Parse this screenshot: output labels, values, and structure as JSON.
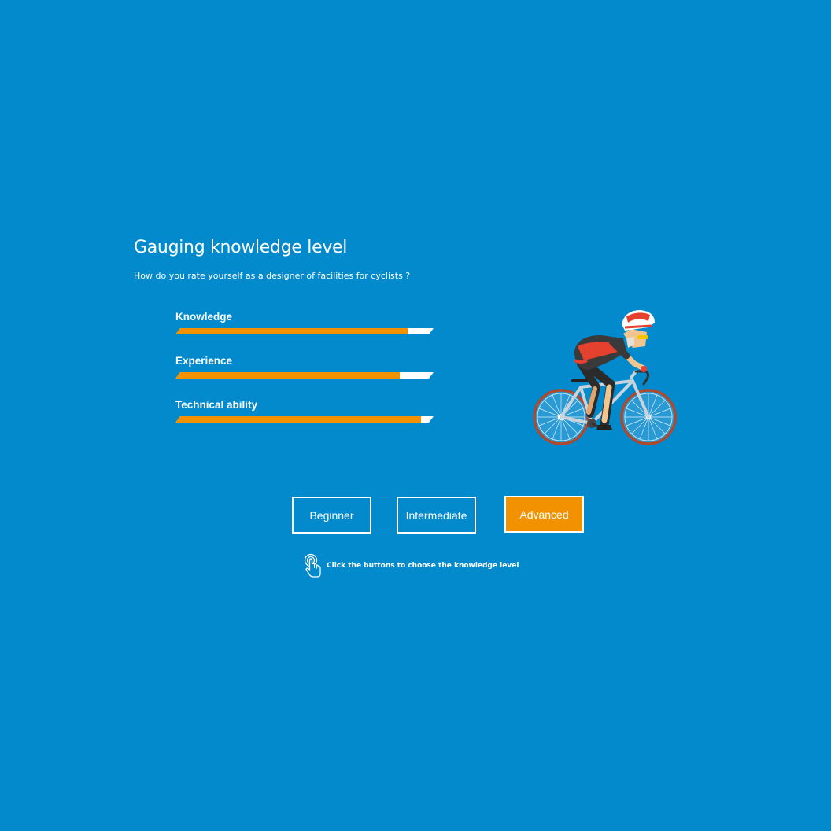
{
  "page": {
    "title": "Gauging knowledge level",
    "question": "How do you rate yourself as a designer of facilities for cyclists ?"
  },
  "colors": {
    "background": "#028acd",
    "accent": "#f39200",
    "text": "#ffffff"
  },
  "meters": [
    {
      "label": "Knowledge",
      "value_percent": 90
    },
    {
      "label": "Experience",
      "value_percent": 87
    },
    {
      "label": "Technical ability",
      "value_percent": 95
    }
  ],
  "levels": {
    "beginner": "Beginner",
    "intermediate": "Intermediate",
    "advanced": "Advanced",
    "selected": "Advanced"
  },
  "hint": {
    "icon": "tap-hand-icon",
    "text": "Click the buttons to choose the knowledge level"
  },
  "illustration": {
    "icon": "cyclist-illustration"
  }
}
